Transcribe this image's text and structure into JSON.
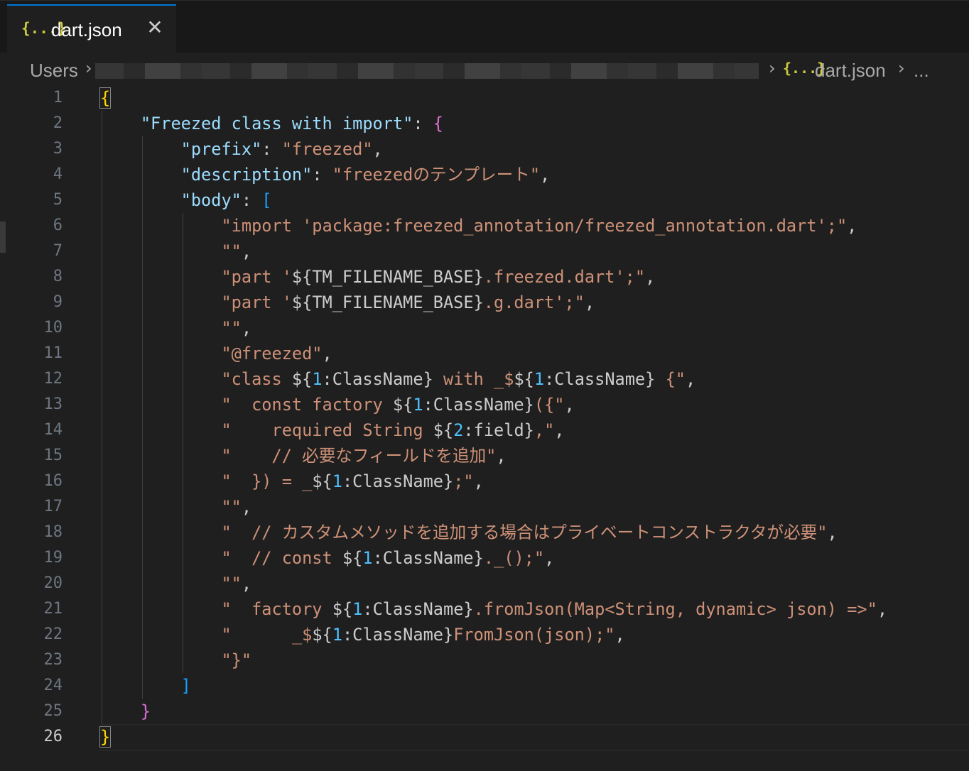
{
  "tab": {
    "icon": "{...}",
    "icon_name": "json-braces-icon",
    "label": "dart.json",
    "close_glyph": "✕"
  },
  "breadcrumbs": {
    "root": "Users",
    "separator": "›",
    "file_icon": "{...}",
    "file": "dart.json",
    "more": "..."
  },
  "colors": {
    "accent": "#0078d4",
    "string": "#ce9178",
    "key": "#9cdcfe",
    "variable": "#4fc1ff",
    "bracket_level1": "#ffd700",
    "bracket_level2": "#da70d6",
    "bracket_level3": "#179fff"
  },
  "editor": {
    "active_line": 26,
    "line_numbers": [
      "1",
      "2",
      "3",
      "4",
      "5",
      "6",
      "7",
      "8",
      "9",
      "10",
      "11",
      "12",
      "13",
      "14",
      "15",
      "16",
      "17",
      "18",
      "19",
      "20",
      "21",
      "22",
      "23",
      "24",
      "25",
      "26"
    ],
    "lines": [
      [
        {
          "t": "{",
          "c": "b1 bb"
        }
      ],
      [
        {
          "t": "    "
        },
        {
          "t": "\"Freezed class with import\"",
          "c": "k"
        },
        {
          "t": ": ",
          "c": "p"
        },
        {
          "t": "{",
          "c": "b2"
        }
      ],
      [
        {
          "t": "        "
        },
        {
          "t": "\"prefix\"",
          "c": "k"
        },
        {
          "t": ": ",
          "c": "p"
        },
        {
          "t": "\"freezed\"",
          "c": "s"
        },
        {
          "t": ",",
          "c": "p"
        }
      ],
      [
        {
          "t": "        "
        },
        {
          "t": "\"description\"",
          "c": "k"
        },
        {
          "t": ": ",
          "c": "p"
        },
        {
          "t": "\"freezedのテンプレート\"",
          "c": "s"
        },
        {
          "t": ",",
          "c": "p"
        }
      ],
      [
        {
          "t": "        "
        },
        {
          "t": "\"body\"",
          "c": "k"
        },
        {
          "t": ": ",
          "c": "p"
        },
        {
          "t": "[",
          "c": "b3"
        }
      ],
      [
        {
          "t": "            "
        },
        {
          "t": "\"import 'package:freezed_annotation/freezed_annotation.dart';\"",
          "c": "s"
        },
        {
          "t": ",",
          "c": "p"
        }
      ],
      [
        {
          "t": "            "
        },
        {
          "t": "\"\"",
          "c": "s"
        },
        {
          "t": ",",
          "c": "p"
        }
      ],
      [
        {
          "t": "            "
        },
        {
          "t": "\"part '",
          "c": "s"
        },
        {
          "t": "${TM_FILENAME_BASE}",
          "c": "p"
        },
        {
          "t": ".freezed.dart';\"",
          "c": "s"
        },
        {
          "t": ",",
          "c": "p"
        }
      ],
      [
        {
          "t": "            "
        },
        {
          "t": "\"part '",
          "c": "s"
        },
        {
          "t": "${TM_FILENAME_BASE}",
          "c": "p"
        },
        {
          "t": ".g.dart';\"",
          "c": "s"
        },
        {
          "t": ",",
          "c": "p"
        }
      ],
      [
        {
          "t": "            "
        },
        {
          "t": "\"\"",
          "c": "s"
        },
        {
          "t": ",",
          "c": "p"
        }
      ],
      [
        {
          "t": "            "
        },
        {
          "t": "\"@freezed\"",
          "c": "s"
        },
        {
          "t": ",",
          "c": "p"
        }
      ],
      [
        {
          "t": "            "
        },
        {
          "t": "\"class ",
          "c": "s"
        },
        {
          "t": "${",
          "c": "p"
        },
        {
          "t": "1",
          "c": "v"
        },
        {
          "t": ":ClassName}",
          "c": "p"
        },
        {
          "t": " with _$",
          "c": "s"
        },
        {
          "t": "${",
          "c": "p"
        },
        {
          "t": "1",
          "c": "v"
        },
        {
          "t": ":ClassName}",
          "c": "p"
        },
        {
          "t": " {\"",
          "c": "s"
        },
        {
          "t": ",",
          "c": "p"
        }
      ],
      [
        {
          "t": "            "
        },
        {
          "t": "\"  const factory ",
          "c": "s"
        },
        {
          "t": "${",
          "c": "p"
        },
        {
          "t": "1",
          "c": "v"
        },
        {
          "t": ":ClassName}",
          "c": "p"
        },
        {
          "t": "({\"",
          "c": "s"
        },
        {
          "t": ",",
          "c": "p"
        }
      ],
      [
        {
          "t": "            "
        },
        {
          "t": "\"    required String ",
          "c": "s"
        },
        {
          "t": "${",
          "c": "p"
        },
        {
          "t": "2",
          "c": "v"
        },
        {
          "t": ":field}",
          "c": "p"
        },
        {
          "t": ",\"",
          "c": "s"
        },
        {
          "t": ",",
          "c": "p"
        }
      ],
      [
        {
          "t": "            "
        },
        {
          "t": "\"    // 必要なフィールドを追加\"",
          "c": "s"
        },
        {
          "t": ",",
          "c": "p"
        }
      ],
      [
        {
          "t": "            "
        },
        {
          "t": "\"  }) = _",
          "c": "s"
        },
        {
          "t": "${",
          "c": "p"
        },
        {
          "t": "1",
          "c": "v"
        },
        {
          "t": ":ClassName}",
          "c": "p"
        },
        {
          "t": ";\"",
          "c": "s"
        },
        {
          "t": ",",
          "c": "p"
        }
      ],
      [
        {
          "t": "            "
        },
        {
          "t": "\"\"",
          "c": "s"
        },
        {
          "t": ",",
          "c": "p"
        }
      ],
      [
        {
          "t": "            "
        },
        {
          "t": "\"  // カスタムメソッドを追加する場合はプライベートコンストラクタが必要\"",
          "c": "s"
        },
        {
          "t": ",",
          "c": "p"
        }
      ],
      [
        {
          "t": "            "
        },
        {
          "t": "\"  // const ",
          "c": "s"
        },
        {
          "t": "${",
          "c": "p"
        },
        {
          "t": "1",
          "c": "v"
        },
        {
          "t": ":ClassName}",
          "c": "p"
        },
        {
          "t": "._();\"",
          "c": "s"
        },
        {
          "t": ",",
          "c": "p"
        }
      ],
      [
        {
          "t": "            "
        },
        {
          "t": "\"\"",
          "c": "s"
        },
        {
          "t": ",",
          "c": "p"
        }
      ],
      [
        {
          "t": "            "
        },
        {
          "t": "\"  factory ",
          "c": "s"
        },
        {
          "t": "${",
          "c": "p"
        },
        {
          "t": "1",
          "c": "v"
        },
        {
          "t": ":ClassName}",
          "c": "p"
        },
        {
          "t": ".fromJson(Map<String, dynamic> json) =>\"",
          "c": "s"
        },
        {
          "t": ",",
          "c": "p"
        }
      ],
      [
        {
          "t": "            "
        },
        {
          "t": "\"      _$",
          "c": "s"
        },
        {
          "t": "${",
          "c": "p"
        },
        {
          "t": "1",
          "c": "v"
        },
        {
          "t": ":ClassName}",
          "c": "p"
        },
        {
          "t": "FromJson(json);\"",
          "c": "s"
        },
        {
          "t": ",",
          "c": "p"
        }
      ],
      [
        {
          "t": "            "
        },
        {
          "t": "\"}\"",
          "c": "s"
        }
      ],
      [
        {
          "t": "        "
        },
        {
          "t": "]",
          "c": "b3"
        }
      ],
      [
        {
          "t": "    "
        },
        {
          "t": "}",
          "c": "b2"
        }
      ],
      [
        {
          "t": "}",
          "c": "b1 bb"
        }
      ]
    ]
  }
}
